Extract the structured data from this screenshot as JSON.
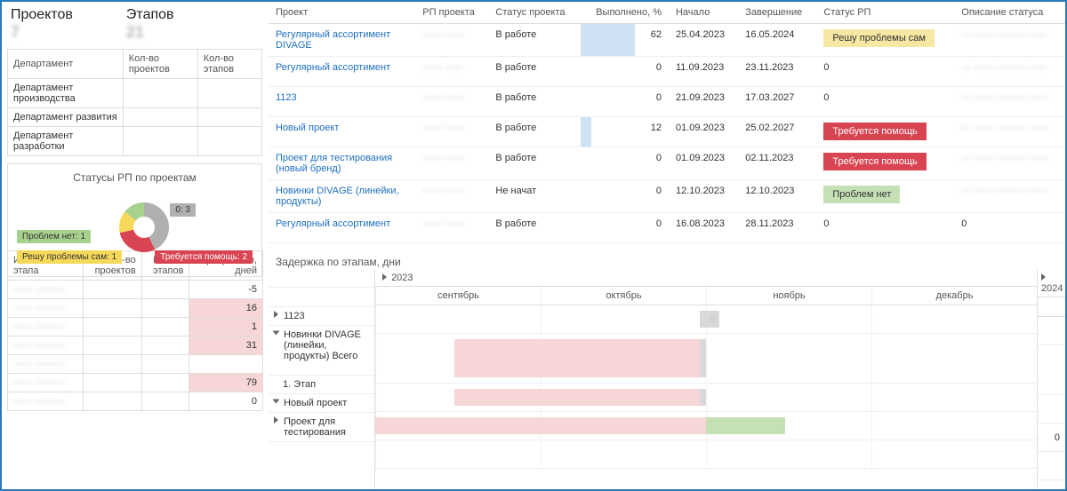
{
  "kpi": {
    "projects_label": "Проектов",
    "projects_value": "7",
    "stages_label": "Этапов",
    "stages_value": "21"
  },
  "dept_table": {
    "headers": [
      "Департамент",
      "Кол-во проектов",
      "Кол-во этапов"
    ],
    "rows": [
      {
        "name": "Департамент производства",
        "p": " ",
        "s": " "
      },
      {
        "name": "Департамент развития",
        "p": " ",
        "s": " "
      },
      {
        "name": "Департамент разработки",
        "p": " ",
        "s": " "
      }
    ]
  },
  "donut": {
    "title": "Статусы РП по проектам",
    "labels": {
      "none": "0: 3",
      "ok": "Проблем нет: 1",
      "self": "Решу проблемы сам: 1",
      "help": "Требуется помощь: 2"
    }
  },
  "chart_data": {
    "type": "pie",
    "title": "Статусы РП по проектам",
    "categories": [
      "0",
      "Требуется помощь",
      "Решу проблемы сам",
      "Проблем нет"
    ],
    "values": [
      3,
      2,
      1,
      1
    ],
    "colors": [
      "#b0b0b0",
      "#d94452",
      "#f6d95b",
      "#a8d18d"
    ]
  },
  "projects": {
    "headers": [
      "Проект",
      "РП проекта",
      "Статус проекта",
      "Выполнено, %",
      "Начало",
      "Завершение",
      "Статус РП",
      "Описание статуса"
    ],
    "rows": [
      {
        "name": "Регулярный ассортимент DIVAGE",
        "rp": "—",
        "status": "В работе",
        "pct": 62,
        "start": "25.04.2023",
        "end": "16.05.2024",
        "rp_status": "Решу проблемы сам",
        "rp_class": "yellow",
        "desc": "—"
      },
      {
        "name": "Регулярный ассортимент",
        "rp": "—",
        "status": "В работе",
        "pct": 0,
        "start": "11.09.2023",
        "end": "23.11.2023",
        "rp_status": "0",
        "rp_class": "",
        "desc": ""
      },
      {
        "name": "1123",
        "rp": "—",
        "status": "В работе",
        "pct": 0,
        "start": "21.09.2023",
        "end": "17.03.2027",
        "rp_status": "0",
        "rp_class": "",
        "desc": ""
      },
      {
        "name": "Новый проект",
        "rp": "—",
        "status": "В работе",
        "pct": 12,
        "start": "01.09.2023",
        "end": "25.02.2027",
        "rp_status": "Требуется помощь",
        "rp_class": "red",
        "desc": "—"
      },
      {
        "name": "Проект для тестирования (новый бренд)",
        "rp": "—",
        "status": "В работе",
        "pct": 0,
        "start": "01.09.2023",
        "end": "02.11.2023",
        "rp_status": "Требуется помощь",
        "rp_class": "red",
        "desc": "—"
      },
      {
        "name": "Новинки DIVAGE (линейки, продукты)",
        "rp": "—",
        "status": "Не начат",
        "pct": 0,
        "start": "12.10.2023",
        "end": "12.10.2023",
        "rp_status": "Проблем нет",
        "rp_class": "green",
        "desc": "—"
      },
      {
        "name": "Регулярный ассортимент",
        "rp": "—",
        "status": "В работе",
        "pct": 0,
        "start": "16.08.2023",
        "end": "28.11.2023",
        "rp_status": "0",
        "rp_class": "",
        "desc": "0"
      }
    ]
  },
  "stages": {
    "headers": [
      "Исполнитель этапа",
      "Кол-во проектов",
      "Кол-во этапов",
      "Просрочено, дней"
    ],
    "rows": [
      {
        "name": "—",
        "p": " ",
        "s": " ",
        "late": -5,
        "late_class": ""
      },
      {
        "name": "—",
        "p": " ",
        "s": " ",
        "late": 16,
        "late_class": "late"
      },
      {
        "name": "—",
        "p": " ",
        "s": " ",
        "late": 1,
        "late_class": "late"
      },
      {
        "name": "—",
        "p": " ",
        "s": " ",
        "late": 31,
        "late_class": "late"
      },
      {
        "name": "—",
        "p": " ",
        "s": " ",
        "late": " ",
        "late_class": ""
      },
      {
        "name": "—",
        "p": " ",
        "s": " ",
        "late": 79,
        "late_class": "late"
      },
      {
        "name": "—",
        "p": " ",
        "s": " ",
        "late": 0,
        "late_class": ""
      }
    ]
  },
  "gantt": {
    "title": "Задержка по этапам, дни",
    "year_left": "2023",
    "year_right": "2024",
    "months": [
      "сентябрь",
      "октябрь",
      "ноябрь",
      "декабрь"
    ],
    "rows": [
      {
        "label": "1123",
        "collapsed": true
      },
      {
        "label": "Новинки DIVAGE (линейки, продукты) Всего",
        "collapsed": false
      },
      {
        "label": "1. Этап",
        "sub": true
      },
      {
        "label": "Новый проект",
        "collapsed": false
      },
      {
        "label": "Проект для тестирования",
        "collapsed": true
      }
    ],
    "right_values": [
      "",
      "",
      "",
      "0",
      ""
    ]
  }
}
